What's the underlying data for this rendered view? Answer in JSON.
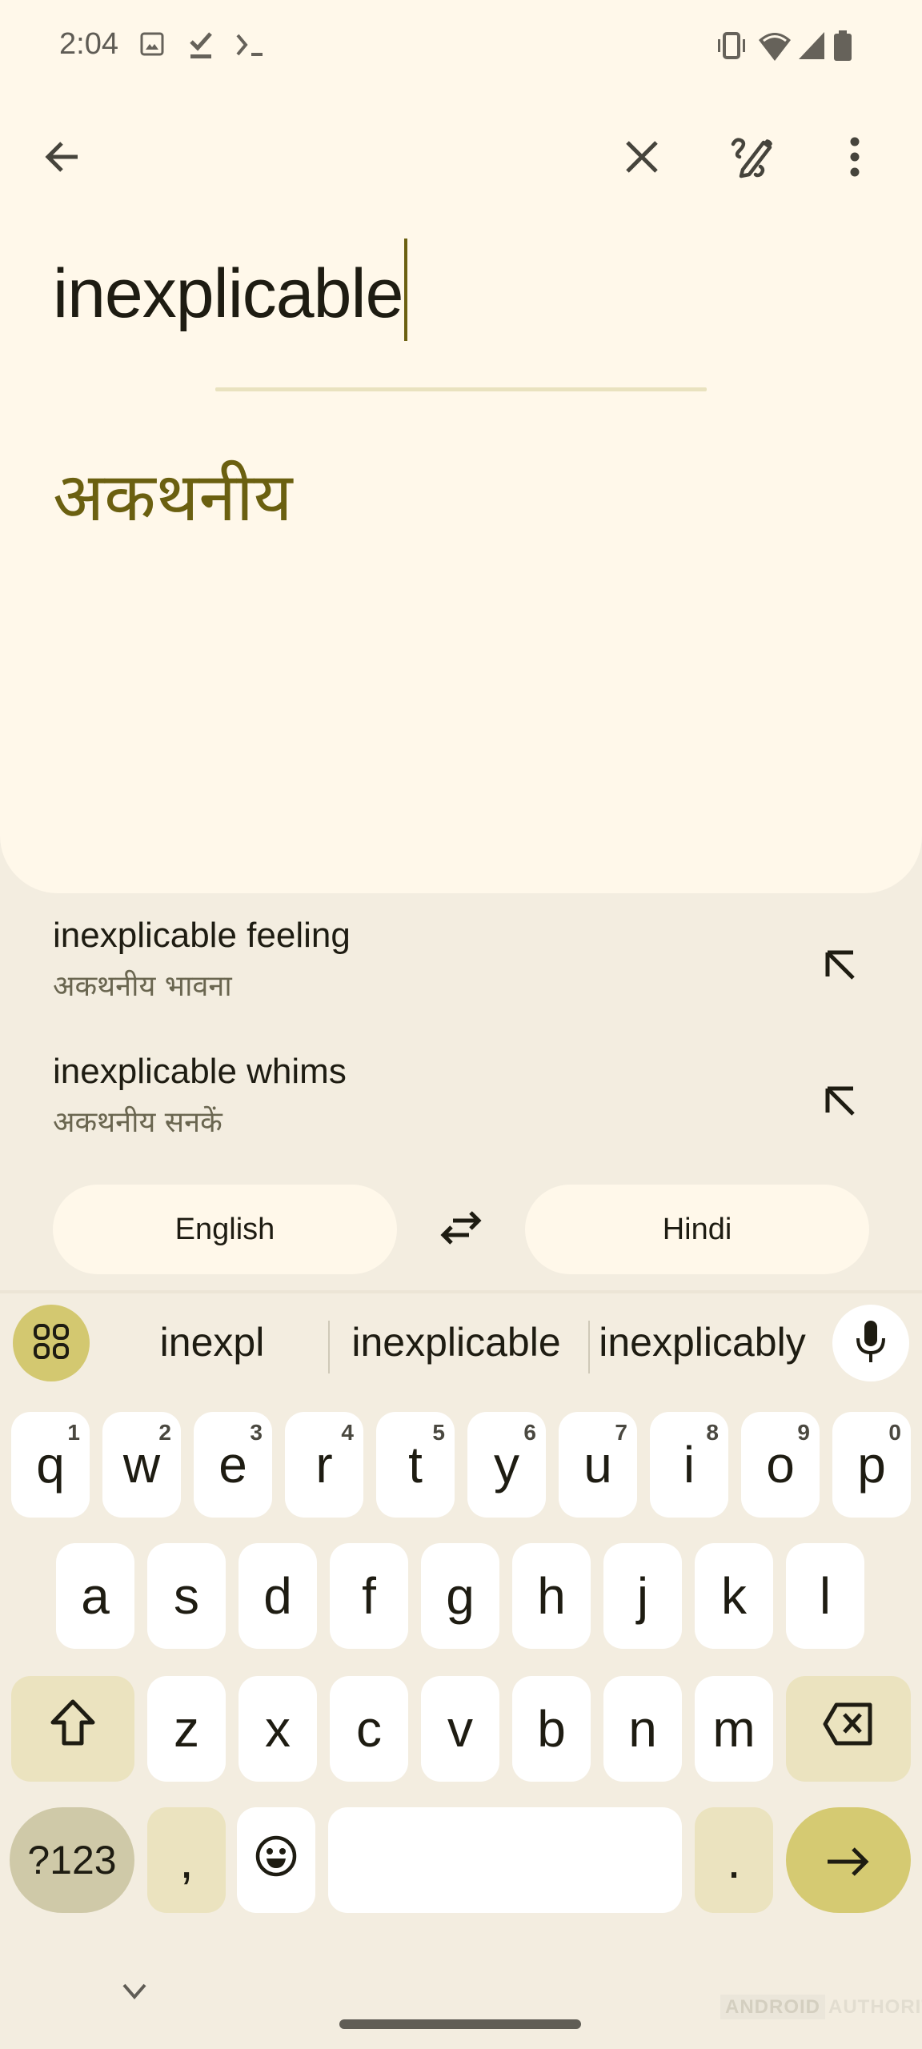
{
  "status_bar": {
    "time": "2:04",
    "left_icons": [
      "image-icon",
      "download-done-icon",
      "terminal-icon"
    ],
    "right_icons": [
      "vibrate-icon",
      "wifi-icon",
      "signal-icon",
      "battery-icon"
    ]
  },
  "app_bar": {
    "back_icon": "arrow-back-icon",
    "actions": [
      "close-icon",
      "handwriting-icon",
      "more-vert-icon"
    ]
  },
  "source": {
    "text": "inexplicable"
  },
  "translation": {
    "text": "अकथनीय"
  },
  "suggestions": [
    {
      "english": "inexplicable feeling",
      "hindi": "अकथनीय भावना",
      "icon": "arrow-up-left-icon"
    },
    {
      "english": "inexplicable whims",
      "hindi": "अकथनीय सनकें",
      "icon": "arrow-up-left-icon"
    }
  ],
  "languages": {
    "source": "English",
    "target": "Hindi",
    "swap_icon": "swap-horiz-icon"
  },
  "keyboard": {
    "word_suggestions": [
      "inexpl",
      "inexplicable",
      "inexplicably"
    ],
    "row1": [
      {
        "key": "q",
        "hint": "1"
      },
      {
        "key": "w",
        "hint": "2"
      },
      {
        "key": "e",
        "hint": "3"
      },
      {
        "key": "r",
        "hint": "4"
      },
      {
        "key": "t",
        "hint": "5"
      },
      {
        "key": "y",
        "hint": "6"
      },
      {
        "key": "u",
        "hint": "7"
      },
      {
        "key": "i",
        "hint": "8"
      },
      {
        "key": "o",
        "hint": "9"
      },
      {
        "key": "p",
        "hint": "0"
      }
    ],
    "row2": [
      "a",
      "s",
      "d",
      "f",
      "g",
      "h",
      "j",
      "k",
      "l"
    ],
    "row3": [
      "z",
      "x",
      "c",
      "v",
      "b",
      "n",
      "m"
    ],
    "symbols_label": "?123",
    "comma_label": ",",
    "period_label": ".",
    "space_label": ""
  },
  "watermark": {
    "brand": "ANDROID",
    "suffix": "AUTHORITY"
  },
  "colors": {
    "background": "#f3ede0",
    "card": "#fff8ea",
    "accent_text": "#6b6010",
    "enter_key": "#d5ca72",
    "modifier_key": "#ebe3bf"
  }
}
